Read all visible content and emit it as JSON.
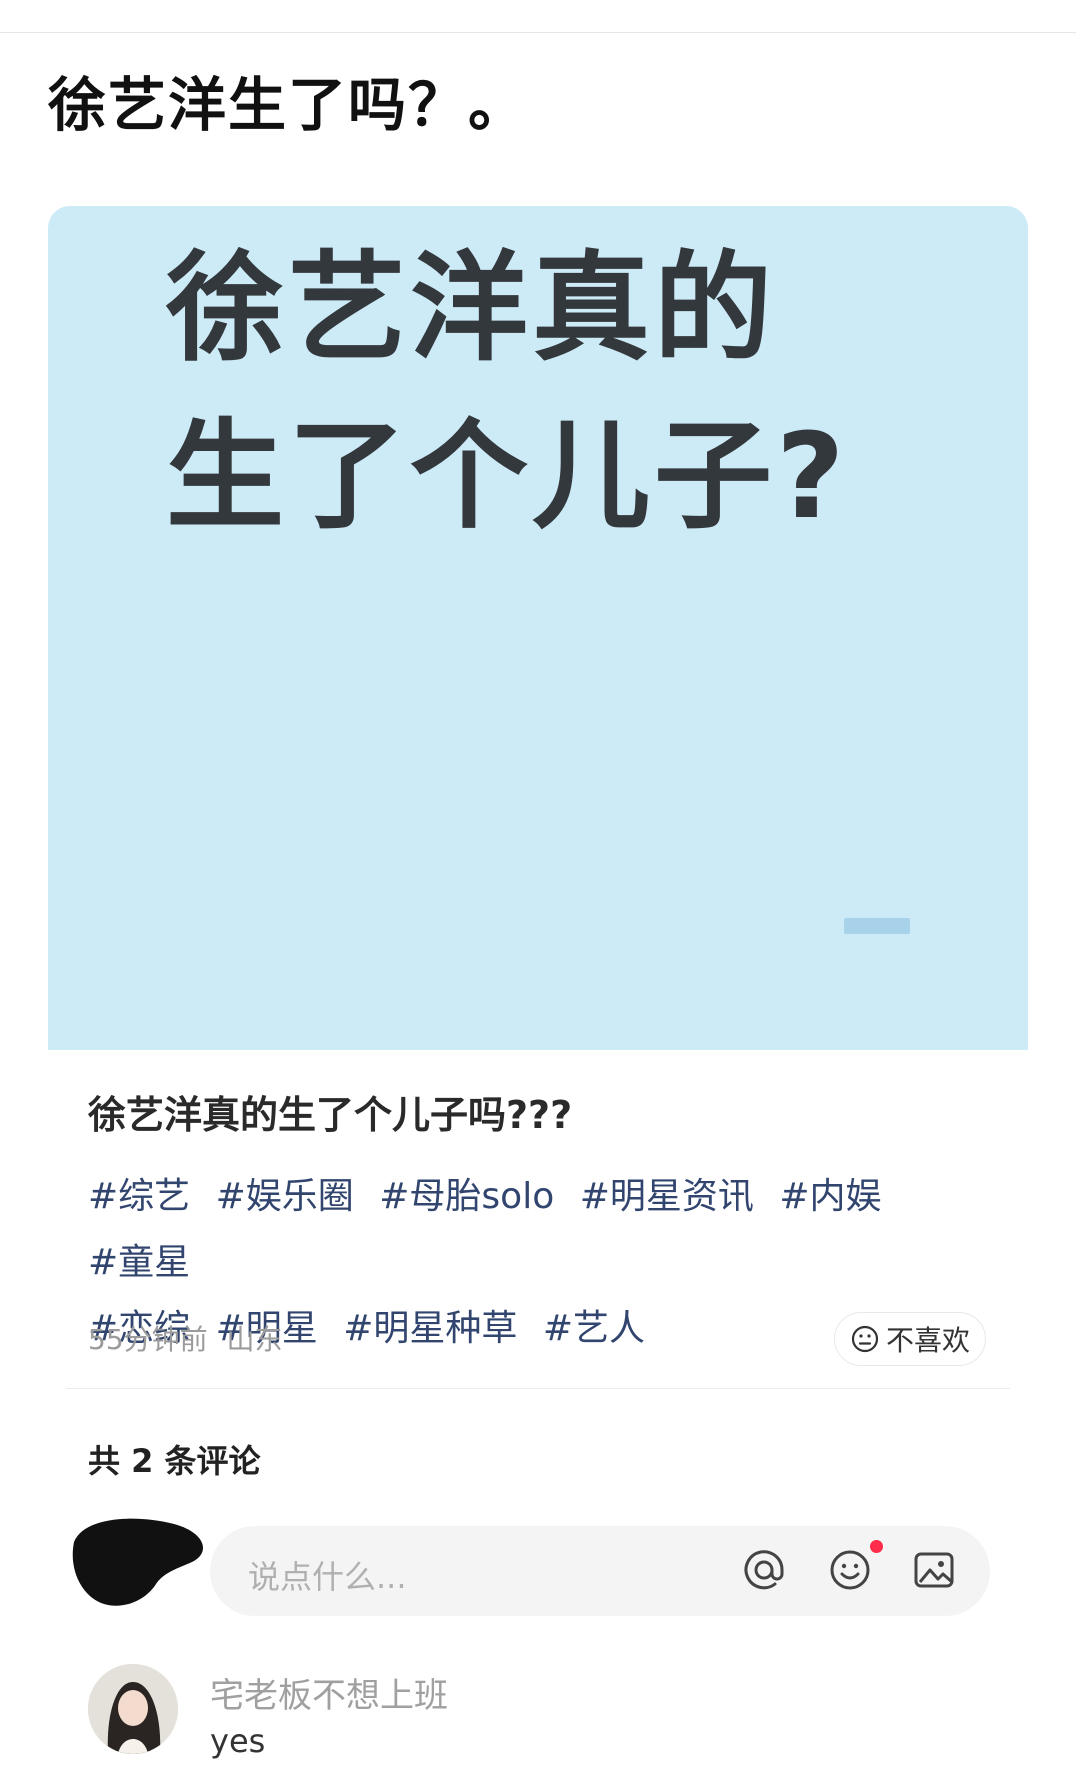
{
  "overlay_title": "徐艺洋生了吗？。",
  "image_card": {
    "line1": "徐艺洋真的",
    "line2": "生了个儿子?"
  },
  "post": {
    "title": "徐艺洋真的生了个儿子吗???",
    "tags": [
      "#综艺",
      "#娱乐圈",
      "#母胎solo",
      "#明星资讯",
      "#内娱",
      "#童星",
      "#恋综",
      "#明星",
      "#明星种草",
      "#艺人"
    ],
    "time": "55分钟前",
    "location": "山东",
    "dislike_label": "不喜欢"
  },
  "comments": {
    "count_label": "共 2 条评论",
    "input_placeholder": "说点什么...",
    "items": [
      {
        "author": "宅老板不想上班",
        "text": "yes"
      }
    ]
  },
  "icons": {
    "dislike": "neutral-face-icon",
    "mention": "at-icon",
    "emoji": "smiley-icon",
    "image": "image-icon"
  },
  "colors": {
    "image_card_bg": "#cdebf7",
    "tag_color": "#31456f",
    "notification_dot": "#ff2b4a"
  }
}
